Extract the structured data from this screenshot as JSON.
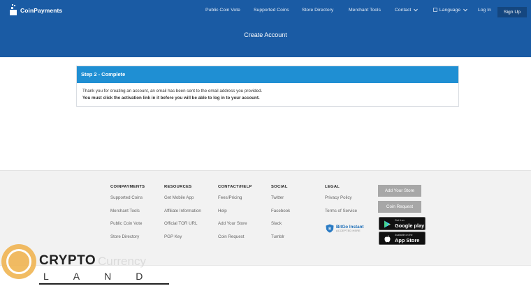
{
  "header": {
    "logo_text": "CoinPayments",
    "nav": [
      {
        "label": "Public Coin Vote"
      },
      {
        "label": "Supported Coins"
      },
      {
        "label": "Store Directory"
      },
      {
        "label": "Merchant Tools"
      },
      {
        "label": "Contact"
      },
      {
        "label": "Language"
      },
      {
        "label": "Log In"
      }
    ],
    "signup_label": "Sign Up",
    "page_title": "Create Account"
  },
  "card": {
    "title": "Step 2 - Complete",
    "line1": "Thank you for creating an account, an email has been sent to the email address you provided.",
    "line2": "You must click the activation link in it before you will be able to log in to your account."
  },
  "footer": {
    "columns": [
      {
        "heading": "COINPAYMENTS",
        "links": [
          "Supported Coins",
          "Merchant Tools",
          "Public Coin Vote",
          "Store Directory"
        ]
      },
      {
        "heading": "RESOURCES",
        "links": [
          "Get Mobile App",
          "Affiliate Information",
          "Official TOR URL",
          "PGP Key"
        ]
      },
      {
        "heading": "CONTACT/HELP",
        "links": [
          "Fees/Pricing",
          "Help",
          "Add Your Store",
          "Coin Request"
        ]
      },
      {
        "heading": "SOCIAL",
        "links": [
          "Twitter",
          "Facebook",
          "Slack",
          "Tumblr"
        ]
      },
      {
        "heading": "LEGAL",
        "links": [
          "Privacy Policy",
          "Terms of Service"
        ]
      }
    ],
    "bitgo_title": "BitGo Instant",
    "bitgo_sub": "ACCEPTED HERE",
    "add_store_label": "Add Your Store",
    "coin_request_label": "Coin Request",
    "google_play_small": "Get it on",
    "google_play_big": "Google play",
    "app_store_small": "Available on the",
    "app_store_big": "App Store"
  },
  "watermark": {
    "word1": "CRYPTO",
    "word2": "Currency",
    "word3": "LAND"
  },
  "colors": {
    "header_bg": "#1a5ba4",
    "card_head_bg": "#1f8fd3",
    "footer_bg": "#f2f2f2",
    "gray_button": "#a7a7a7"
  }
}
